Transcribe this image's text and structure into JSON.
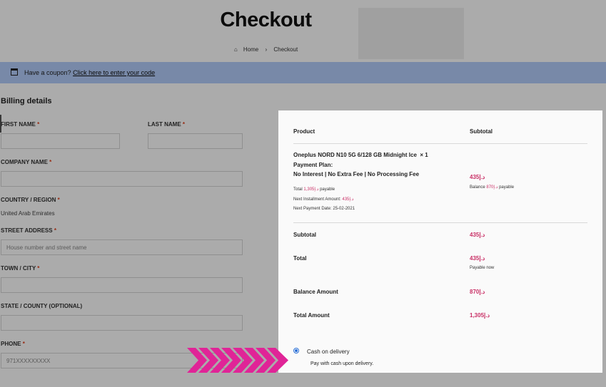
{
  "header": {
    "title": "Checkout",
    "breadcrumb": {
      "home": "Home",
      "separator": "›",
      "current": "Checkout"
    }
  },
  "coupon": {
    "prefix": "Have a coupon?",
    "link": "Click here to enter your code"
  },
  "billing": {
    "title": "Billing details",
    "fields": {
      "first_name": {
        "label": "FIRST NAME",
        "required": "*"
      },
      "last_name": {
        "label": "LAST NAME",
        "required": "*"
      },
      "company": {
        "label": "COMPANY NAME",
        "required": "*"
      },
      "country": {
        "label": "COUNTRY / REGION",
        "required": "*",
        "value": "United Arab Emirates"
      },
      "street": {
        "label": "STREET ADDRESS",
        "required": "*",
        "placeholder": "House number and street name"
      },
      "town": {
        "label": "TOWN / CITY",
        "required": "*"
      },
      "state": {
        "label": "STATE / COUNTY (OPTIONAL)"
      },
      "phone": {
        "label": "PHONE",
        "required": "*",
        "placeholder": "971XXXXXXXXX"
      }
    }
  },
  "order": {
    "headers": {
      "product": "Product",
      "subtotal": "Subtotal"
    },
    "item": {
      "name": "Oneplus NORD N10 5G 6/128 GB Midnight Ice",
      "qty": "× 1",
      "plan_label": "Payment Plan:",
      "plan_value": "No Interest | No Extra Fee | No Processing Fee",
      "price": "435",
      "balance_prefix": "Balance",
      "balance_amount": "870",
      "balance_suffix": "payable",
      "total_prefix": "Total",
      "total_amount": "1,305",
      "total_suffix": "payable",
      "next_installment_label": "Next Installment Amount:",
      "next_installment_amount": "435",
      "next_payment_label": "Next Payment Date:",
      "next_payment_date": "25-02-2021"
    },
    "currency": "د.إ",
    "rows": {
      "subtotal": {
        "label": "Subtotal",
        "value": "435"
      },
      "total": {
        "label": "Total",
        "value": "435",
        "note": "Payable now"
      },
      "balance": {
        "label": "Balance Amount",
        "value": "870"
      },
      "total_amount": {
        "label": "Total Amount",
        "value": "1,305"
      }
    },
    "payment": {
      "method": "Cash on delivery",
      "description": "Pay with cash upon delivery."
    }
  },
  "colors": {
    "accent_pink": "#c93066",
    "coupon_bg": "#b3cdfb",
    "arrow_pink": "#e02497"
  }
}
